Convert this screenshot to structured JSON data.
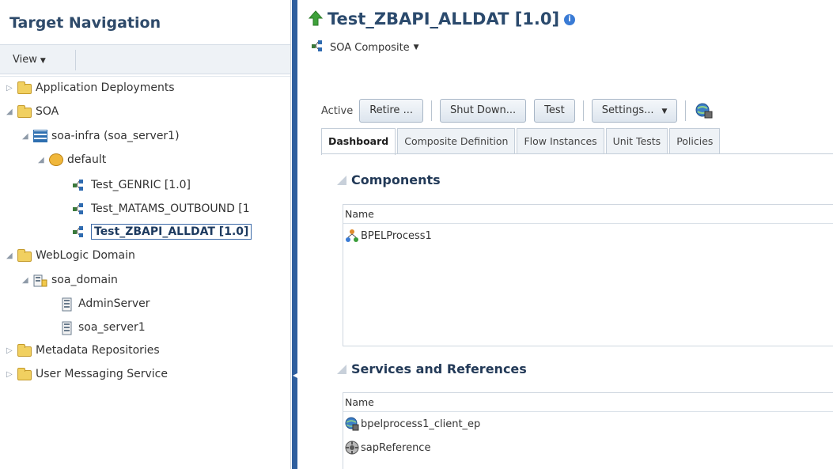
{
  "nav": {
    "title": "Target Navigation",
    "view_menu": "View",
    "tree": [
      {
        "label": "Application Deployments",
        "icon": "folder-icon"
      },
      {
        "label": "SOA",
        "icon": "folder-icon"
      },
      {
        "label": "soa-infra (soa_server1)",
        "icon": "soa-infra-icon"
      },
      {
        "label": "default",
        "icon": "partition-icon"
      },
      {
        "label": "Test_GENRIC [1.0]",
        "icon": "composite-icon"
      },
      {
        "label": "Test_MATAMS_OUTBOUND [1",
        "icon": "composite-icon"
      },
      {
        "label": "Test_ZBAPI_ALLDAT [1.0]",
        "icon": "composite-icon",
        "selected": true
      },
      {
        "label": "WebLogic Domain",
        "icon": "folder-icon"
      },
      {
        "label": "soa_domain",
        "icon": "domain-icon"
      },
      {
        "label": "AdminServer",
        "icon": "server-icon"
      },
      {
        "label": "soa_server1",
        "icon": "server-icon"
      },
      {
        "label": "Metadata Repositories",
        "icon": "folder-icon"
      },
      {
        "label": "User Messaging Service",
        "icon": "folder-icon"
      }
    ]
  },
  "header": {
    "title": "Test_ZBAPI_ALLDAT [1.0]",
    "composite_menu": "SOA Composite"
  },
  "toolbar": {
    "status": "Active",
    "retire": "Retire ...",
    "shutdown": "Shut Down...",
    "test": "Test",
    "settings": "Settings..."
  },
  "tabs": [
    "Dashboard",
    "Composite Definition",
    "Flow Instances",
    "Unit Tests",
    "Policies"
  ],
  "components": {
    "title": "Components",
    "column": "Name",
    "rows": [
      "BPELProcess1"
    ]
  },
  "services": {
    "title": "Services and References",
    "column": "Name",
    "rows": [
      "bpelprocess1_client_ep",
      "sapReference"
    ]
  },
  "colors": {
    "accent": "#2f5f9e",
    "title": "#2b4a6d",
    "folder": "#f1d060"
  }
}
